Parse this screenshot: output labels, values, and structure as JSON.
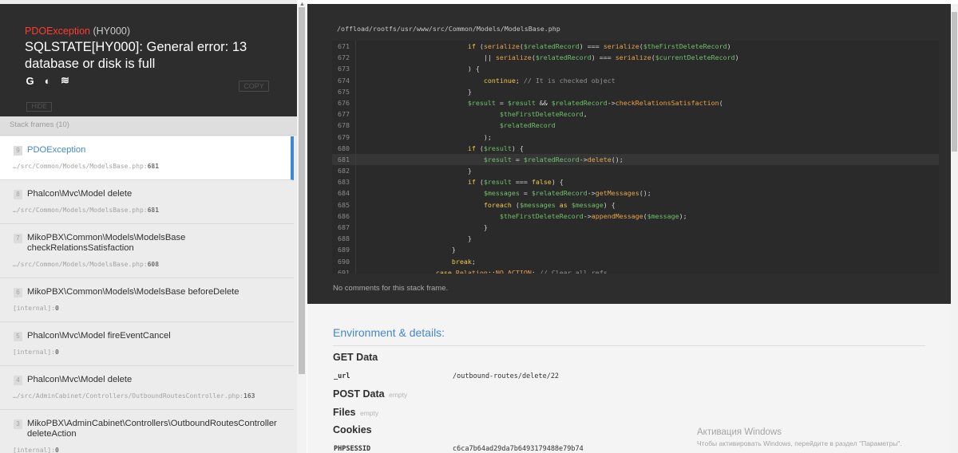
{
  "exception": {
    "class": "PDOException",
    "code": "(HY000)",
    "message": "SQLSTATE[HY000]: General error: 13 database or disk is full",
    "copy_label": "COPY",
    "hide_label": "HIDE"
  },
  "search_links": [
    {
      "icon": "google-icon",
      "glyph": "G"
    },
    {
      "icon": "duckduckgo-icon",
      "glyph": "◐"
    },
    {
      "icon": "stackoverflow-icon",
      "glyph": "≋"
    }
  ],
  "stack": {
    "header": "Stack frames (10)",
    "frames": [
      {
        "num": "9",
        "name": "PDOException",
        "file": "…/src/Common/Models/ModelsBase.php",
        "line": "681"
      },
      {
        "num": "8",
        "name": "Phalcon\\Mvc\\Model delete",
        "file": "…/src/Common/Models/ModelsBase.php",
        "line": "681"
      },
      {
        "num": "7",
        "name": "MikoPBX\\Common\\Models\\ModelsBase checkRelationsSatisfaction",
        "file": "…/src/Common/Models/ModelsBase.php",
        "line": "608"
      },
      {
        "num": "6",
        "name": "MikoPBX\\Common\\Models\\ModelsBase beforeDelete",
        "file": "[internal]",
        "line": "0"
      },
      {
        "num": "5",
        "name": "Phalcon\\Mvc\\Model fireEventCancel",
        "file": "[internal]",
        "line": "0"
      },
      {
        "num": "4",
        "name": "Phalcon\\Mvc\\Model delete",
        "file": "…/src/AdminCabinet/Controllers/OutboundRoutesController.php",
        "line": "163"
      },
      {
        "num": "3",
        "name": "MikoPBX\\AdminCabinet\\Controllers\\OutboundRoutesController deleteAction",
        "file": "[internal]",
        "line": "0"
      }
    ]
  },
  "code": {
    "file_path": "/offload/rootfs/usr/www/src/Common/Models/ModelsBase.php",
    "highlight_line": "681",
    "no_comments": "No comments for this stack frame."
  },
  "environment": {
    "title": "Environment & details:",
    "get_data_title": "GET Data",
    "get_data": [
      {
        "key": "_url",
        "value": "/outbound-routes/delete/22"
      }
    ],
    "post_data_title": "POST Data",
    "post_empty": "empty",
    "files_title": "Files",
    "files_empty": "empty",
    "cookies_title": "Cookies",
    "cookies": [
      {
        "key": "PHPSESSID",
        "value": "c6ca7b64ad29da7b6493179488e79b74"
      }
    ]
  },
  "watermark": {
    "title": "Активация Windows",
    "text": "Чтобы активировать Windows, перейдите в раздел \"Параметры\"."
  }
}
